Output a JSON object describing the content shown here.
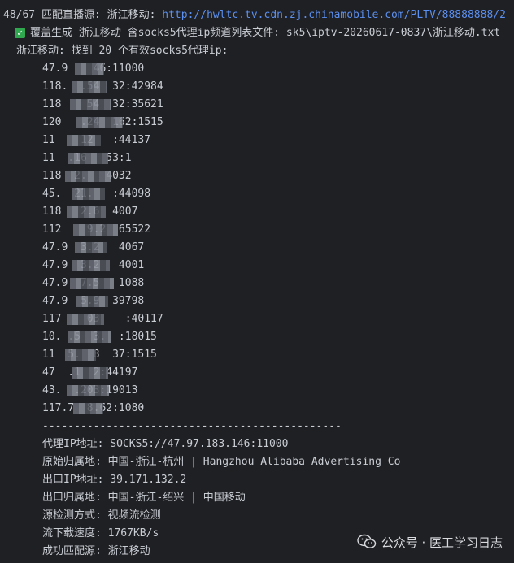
{
  "header": {
    "progress_prefix": "48/67 匹配直播源: 浙江移动: ",
    "url": "http://hwltc.tv.cdn.zj.chinamobile.com/PLTV/88888888/2"
  },
  "overwrite_line": {
    "icon": "check-square-icon",
    "text": "覆盖生成 浙江移动 含socks5代理ip频道列表文件: sk5\\iptv-20260617-0837\\浙江移动.txt"
  },
  "found_line": "浙江移动: 找到 20 个有效socks5代理ip:",
  "ips": [
    "47.9    46:11000",
    "118.  .54  32:42984",
    "118    54  32:35621",
    "120   .24  162:1515",
    "11    12   :44137",
    "11  .16   53:1",
    "118  2.   4032",
    "45.  21.   :44098",
    "118   2.6  4007",
    "112    9.2  65522",
    "47.9  3.2   4067",
    "47.9  3.2   4001",
    "47.9  7.5   1088",
    "47.9  5.9  39798",
    "117    03    :40117",
    "10. .5  3.  :18015",
    "11  5.  8  37:1515",
    "47  .1  2:44197",
    "43.  .203:19013",
    "117.7  8.62:1080"
  ],
  "divider": "-----------------------------------------------",
  "info": {
    "proxy": "代理IP地址: SOCKS5://47.97.183.146:11000",
    "origin_location": "原始归属地: 中国-浙江-杭州 | Hangzhou Alibaba Advertising Co",
    "exit_ip": "出口IP地址: 39.171.132.2",
    "exit_location": "出口归属地: 中国-浙江-绍兴 | 中国移动",
    "detect_method": "源检测方式: 视频流检测",
    "download_speed": "流下载速度: 1767KB/s",
    "matched_source": "成功匹配源: 浙江移动"
  },
  "watermark": {
    "icon": "wechat-icon",
    "text": "公众号 · 医工学习日志"
  },
  "colors": {
    "background": "#1f2023",
    "text": "#c9cdd4",
    "link": "#5b8ff0",
    "check": "#2fa84f"
  }
}
